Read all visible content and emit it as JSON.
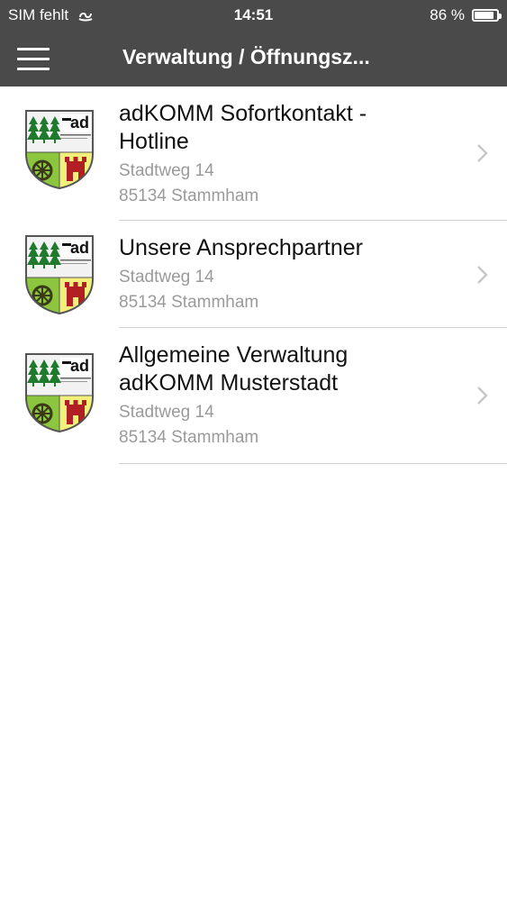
{
  "status": {
    "carrier": "SIM fehlt",
    "time": "14:51",
    "battery": "86 %",
    "battery_level": 0.86
  },
  "navbar": {
    "title": "Verwaltung / Öffnungsz..."
  },
  "items": [
    {
      "title_line1": "adKOMM Sofortkontakt -",
      "title_line2": "Hotline",
      "street": "Stadtweg 14",
      "city": "85134 Stammham"
    },
    {
      "title_line1": "Unsere Ansprechpartner",
      "street": "Stadtweg 14",
      "city": "85134 Stammham"
    },
    {
      "title_line1": "Allgemeine Verwaltung",
      "title_line2": "adKOMM Musterstadt",
      "street": "Stadtweg 14",
      "city": "85134 Stammham"
    }
  ],
  "logo": {
    "text": "ad",
    "colors": {
      "forest": "#f2f2f2",
      "tree": "#1f7a2e",
      "field": "#8cc63f",
      "yellow": "#f2ef7a",
      "tower": "#b11e23",
      "wheel": "#3a3a1a"
    }
  },
  "colors": {
    "bar": "#4a4a4a",
    "divider": "#cfcfcf",
    "title": "#111111",
    "subtitle": "#9a9a9a",
    "chevron": "#c7c7cc"
  }
}
